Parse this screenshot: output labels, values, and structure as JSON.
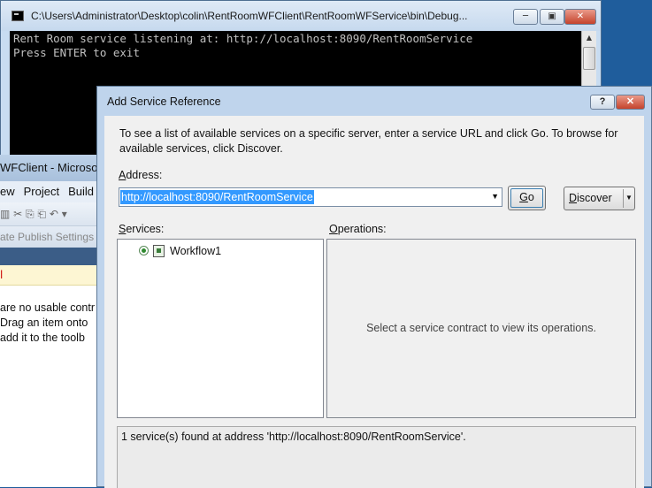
{
  "console": {
    "title": "C:\\Users\\Administrator\\Desktop\\colin\\RentRoomWFClient\\RentRoomWFService\\bin\\Debug...",
    "lines": [
      "Rent Room service listening at: http://localhost:8090/RentRoomService",
      "Press ENTER to exit"
    ],
    "minimize_glyph": "─",
    "restore_glyph": "▣",
    "close_glyph": "✕"
  },
  "vs": {
    "title": "WFClient - Microsof",
    "menu": [
      "ew",
      "Project",
      "Build"
    ],
    "toolbar_text": "▥ ✂ ⎘ ⎗ ↶ ▾",
    "publish_text": "ate Publish Settings",
    "doc_tab": "l",
    "message_lines": [
      "are no usable contr",
      "Drag an item onto",
      "add it to the toolb"
    ]
  },
  "dialog": {
    "title": "Add Service Reference",
    "help_glyph": "?",
    "close_glyph": "✕",
    "intro": "To see a list of available services on a specific server, enter a service URL and click Go. To browse for available services, click Discover.",
    "address_label_key": "A",
    "address_label_rest": "ddress:",
    "address_value": "http://localhost:8090/RentRoomService",
    "go_key": "G",
    "go_rest": "o",
    "discover_key": "D",
    "discover_rest": "iscover",
    "services_label_key": "S",
    "services_label_rest": "ervices:",
    "operations_label_key": "O",
    "operations_label_rest": "perations:",
    "services": [
      {
        "label": "Workflow1"
      }
    ],
    "operations_placeholder": "Select a service contract to view its operations.",
    "status": "1 service(s) found at address 'http://localhost:8090/RentRoomService'."
  }
}
